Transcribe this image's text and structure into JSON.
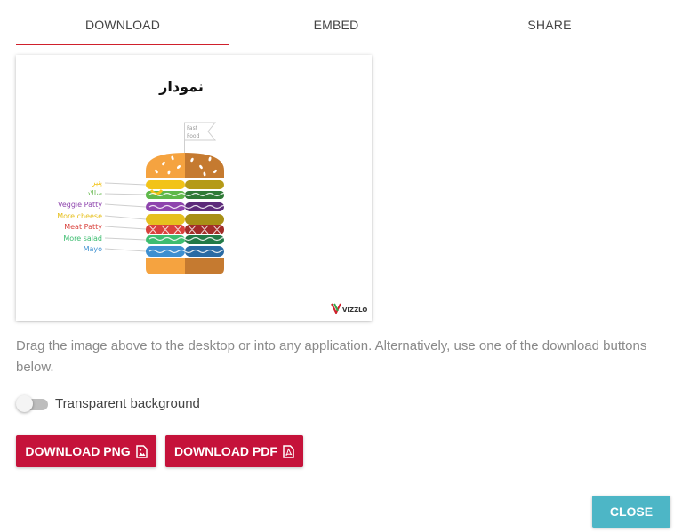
{
  "tabs": [
    {
      "label": "DOWNLOAD",
      "active": true
    },
    {
      "label": "EMBED",
      "active": false
    },
    {
      "label": "SHARE",
      "active": false
    }
  ],
  "preview": {
    "chart_title": "نمودار",
    "flag_text_line1": "Fast",
    "flag_text_line2": "Food",
    "layers": [
      {
        "label": "پنیر",
        "color": "#f2c318"
      },
      {
        "label": "سالاد",
        "color": "#62b74a"
      },
      {
        "label": "Veggie Patty",
        "color": "#8e44ad"
      },
      {
        "label": "More cheese",
        "color": "#e6c01f"
      },
      {
        "label": "Meat Patty",
        "color": "#d9413c"
      },
      {
        "label": "More salad",
        "color": "#3dbd70"
      },
      {
        "label": "Mayo",
        "color": "#3d8fd0"
      }
    ],
    "brand_name": "VIZZLO"
  },
  "help_text": "Drag the image above to the desktop or into any application. Alternatively, use one of the download buttons below.",
  "toggle": {
    "label": "Transparent background",
    "checked": false
  },
  "buttons": {
    "download_png": "DOWNLOAD PNG",
    "download_pdf": "DOWNLOAD PDF",
    "close": "CLOSE"
  },
  "colors": {
    "primary": "#c5123a",
    "tab_indicator": "#d0202c",
    "close": "#4db6c6"
  }
}
